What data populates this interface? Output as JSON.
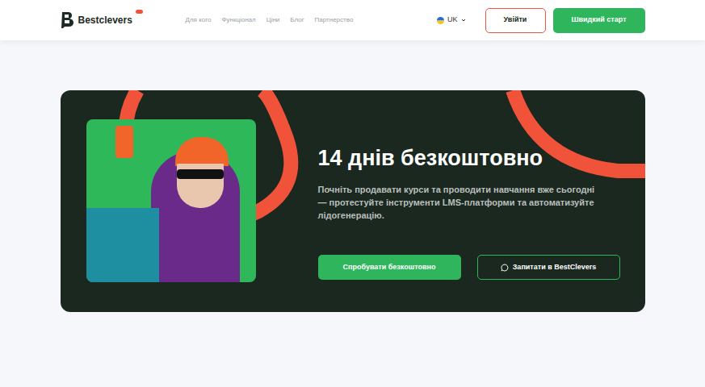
{
  "header": {
    "logo": "Bestclevers",
    "nav": [
      {
        "label": "Для кого"
      },
      {
        "label": "Функціонал"
      },
      {
        "label": "Ціни"
      },
      {
        "label": "Блог"
      },
      {
        "label": "Партнерство"
      }
    ],
    "language": "UK",
    "login_button": "Увійти",
    "start_button": "Швидкий старт"
  },
  "hero": {
    "title": "14 днів безкоштовно",
    "text": "Почніть продавати курси та проводити навчання вже сьогодні — протестуйте інструменти LMS-платформи та автоматизуйте лідогенерацію.",
    "primary_button": "Спробувати безкоштовно",
    "secondary_button": "Запитати в BestClevers"
  }
}
